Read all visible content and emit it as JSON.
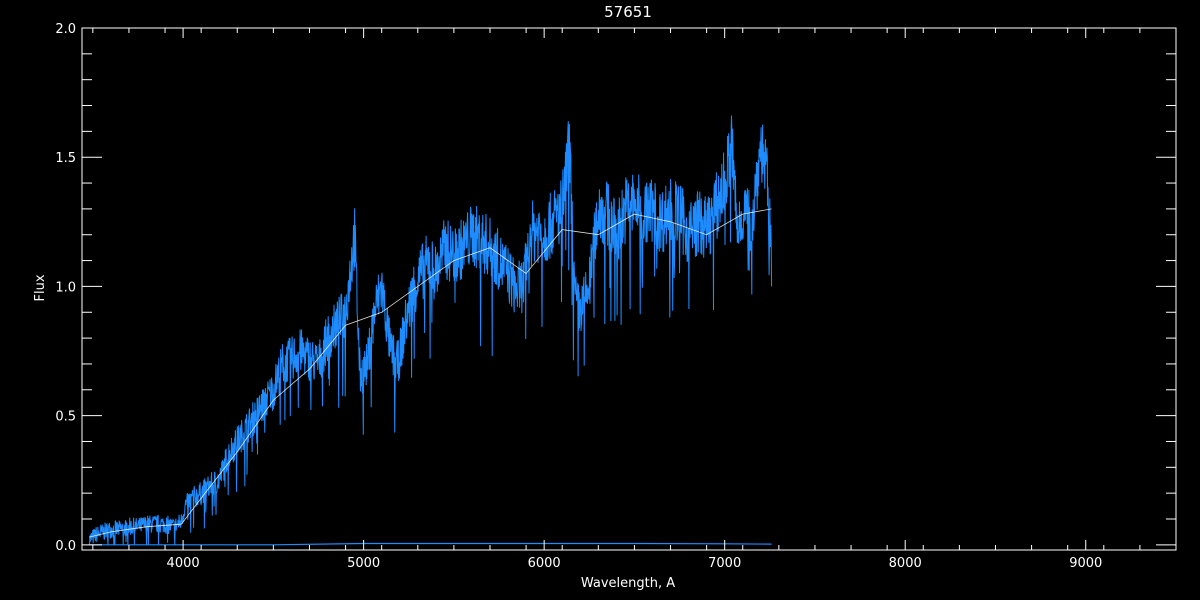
{
  "chart_data": {
    "type": "line",
    "title": "57651",
    "xlabel": "Wavelength, A",
    "ylabel": "Flux",
    "xlim": [
      3440,
      9500
    ],
    "ylim": [
      -0.02,
      2.0
    ],
    "xticks": [
      4000,
      5000,
      6000,
      7000,
      8000,
      9000
    ],
    "xtick_labels": [
      "4000",
      "5000",
      "6000",
      "7000",
      "8000",
      "9000"
    ],
    "yticks": [
      0.0,
      0.5,
      1.0,
      1.5,
      2.0
    ],
    "ytick_labels": [
      "0.0",
      "0.5",
      "1.0",
      "1.5",
      "2.0"
    ],
    "grid": false,
    "colors": {
      "background": "#000000",
      "axes": "#ffffff",
      "spectrum": "#1e8cff",
      "model": "#ffffff",
      "error": "#1e8cff"
    },
    "series": [
      {
        "x": [
          3480,
          3520,
          3560,
          3600,
          3650,
          3700,
          3750,
          3800,
          3850,
          3900,
          3950,
          3990,
          4010,
          4050,
          4100,
          4150,
          4200,
          4250,
          4300,
          4350,
          4400,
          4450,
          4500,
          4550,
          4600,
          4650,
          4700,
          4750,
          4800,
          4850,
          4900,
          4950,
          4980,
          5020,
          5060,
          5100,
          5150,
          5190,
          5230,
          5280,
          5320,
          5360,
          5400,
          5450,
          5500,
          5550,
          5600,
          5650,
          5700,
          5750,
          5800,
          5850,
          5890,
          5920,
          5960,
          6000,
          6050,
          6100,
          6140,
          6170,
          6200,
          6250,
          6300,
          6350,
          6400,
          6450,
          6500,
          6550,
          6600,
          6650,
          6700,
          6750,
          6800,
          6850,
          6900,
          6950,
          7000,
          7040,
          7070,
          7100,
          7150,
          7200,
          7230,
          7260
        ],
        "values": [
          0.02,
          0.04,
          0.05,
          0.06,
          0.06,
          0.07,
          0.07,
          0.08,
          0.08,
          0.08,
          0.07,
          0.09,
          0.15,
          0.18,
          0.2,
          0.23,
          0.25,
          0.35,
          0.4,
          0.45,
          0.5,
          0.55,
          0.6,
          0.7,
          0.72,
          0.75,
          0.72,
          0.7,
          0.8,
          0.85,
          0.9,
          1.2,
          0.65,
          0.7,
          0.9,
          1.0,
          0.75,
          0.7,
          0.85,
          1.0,
          1.05,
          1.1,
          1.05,
          1.15,
          1.12,
          1.15,
          1.2,
          1.18,
          1.15,
          1.1,
          1.05,
          0.98,
          1.02,
          1.2,
          1.22,
          1.2,
          1.25,
          1.3,
          1.55,
          0.95,
          0.9,
          1.0,
          1.3,
          1.28,
          1.2,
          1.3,
          1.32,
          1.28,
          1.3,
          1.25,
          1.3,
          1.28,
          1.2,
          1.25,
          1.22,
          1.3,
          1.4,
          1.55,
          1.2,
          1.3,
          1.25,
          1.55,
          1.45,
          1.1
        ]
      },
      {
        "x": [
          3480,
          3600,
          3800,
          3990,
          4100,
          4300,
          4500,
          4700,
          4900,
          5100,
          5300,
          5500,
          5700,
          5900,
          6100,
          6300,
          6500,
          6700,
          6900,
          7100,
          7260
        ],
        "values": [
          0.03,
          0.05,
          0.07,
          0.08,
          0.18,
          0.36,
          0.56,
          0.68,
          0.85,
          0.9,
          1.0,
          1.1,
          1.15,
          1.05,
          1.22,
          1.2,
          1.28,
          1.25,
          1.2,
          1.28,
          1.3
        ]
      },
      {
        "x": [
          3480,
          4000,
          4500,
          5000,
          5500,
          6000,
          6500,
          7000,
          7260
        ],
        "values": [
          0.0,
          0.0,
          0.0,
          0.005,
          0.005,
          0.005,
          0.005,
          0.004,
          0.003
        ]
      }
    ]
  }
}
